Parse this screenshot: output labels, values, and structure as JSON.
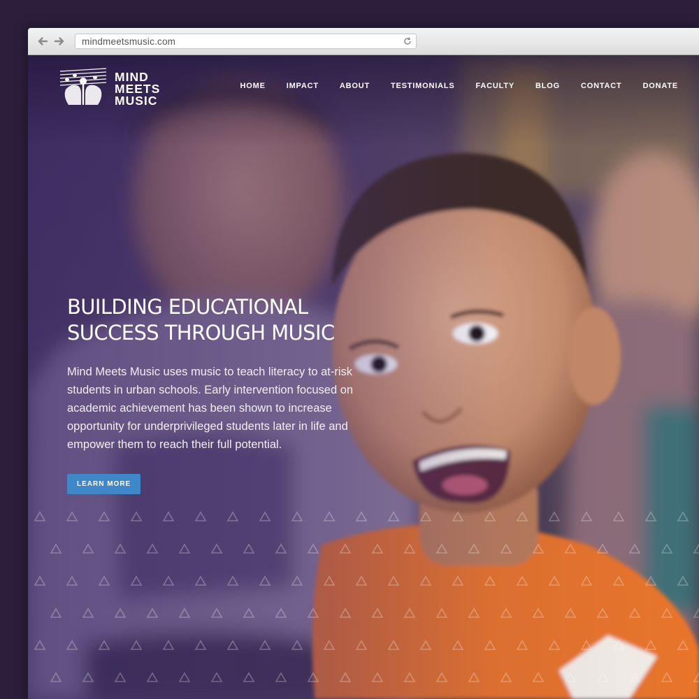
{
  "browser": {
    "url": "mindmeetsmusic.com",
    "back_icon": "back-arrow-icon",
    "forward_icon": "forward-arrow-icon",
    "reload_icon": "reload-icon"
  },
  "site": {
    "logo_lines": [
      "MIND",
      "MEETS",
      "MUSIC"
    ],
    "nav": [
      "HOME",
      "IMPACT",
      "ABOUT",
      "TESTIMONIALS",
      "FACULTY",
      "BLOG",
      "CONTACT",
      "DONATE"
    ]
  },
  "hero": {
    "title_line1": "BUILDING EDUCATIONAL",
    "title_line2": "SUCCESS THROUGH MUSIC",
    "body": "Mind Meets Music uses music to teach literacy to at-risk students in urban schools. Early intervention focused on academic achievement has been shown to increase opportunity for underprivileged students later in life and empower them to reach their full potential.",
    "cta": "LEARN MORE"
  },
  "colors": {
    "accent": "#3f87c9",
    "overlay": "#3c286e",
    "shirt": "#e8742a",
    "page_bg": "#2b1f3b"
  }
}
